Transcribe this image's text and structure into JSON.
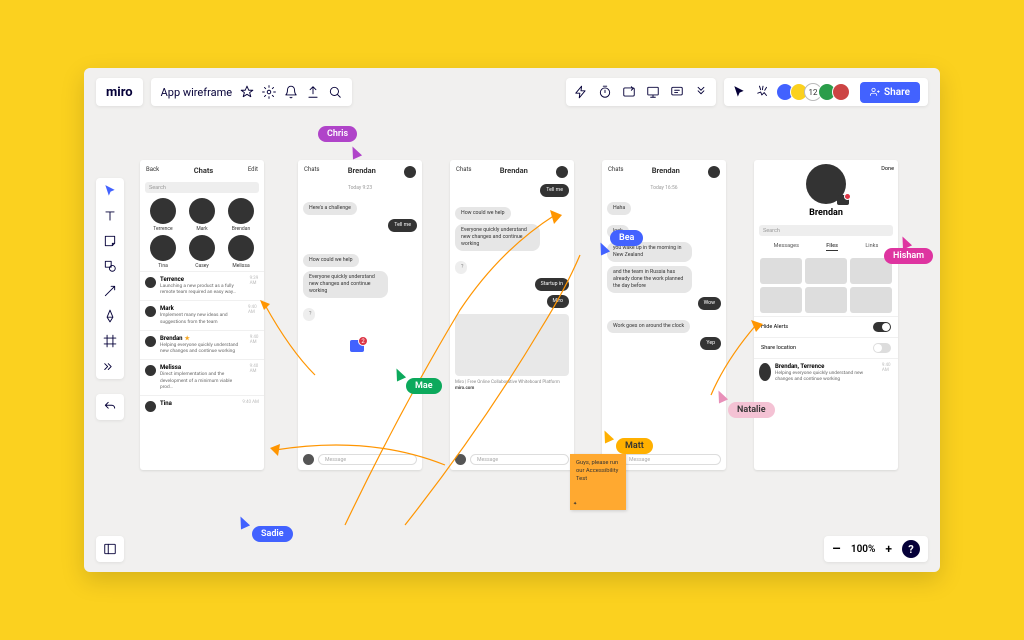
{
  "header": {
    "logo": "miro",
    "board_title": "App wireframe",
    "share": "Share",
    "avatar_count": "12"
  },
  "zoom": {
    "level": "100%",
    "minus": "–",
    "plus": "+",
    "help": "?"
  },
  "mocks": {
    "m1": {
      "back": "Back",
      "title": "Chats",
      "edit": "Edit",
      "search": "Search",
      "avatars": [
        "Terrence",
        "Mark",
        "Brendan",
        "Tina",
        "Casey",
        "Melissa"
      ],
      "rows": [
        {
          "name": "Terrence",
          "time": "9:39 AM",
          "msg": "Launching a new product as a fully remote team required an easy way…"
        },
        {
          "name": "Mark",
          "time": "9:40 AM",
          "msg": "Implement many new ideas and suggestions from the team"
        },
        {
          "name": "Brendan",
          "time": "9:40 AM",
          "msg": "Helping everyone quickly understand new changes and continue working",
          "star": true
        },
        {
          "name": "Melissa",
          "time": "9:40 AM",
          "msg": "Direct implementation and the development of a minimum viable prod…"
        },
        {
          "name": "Tina",
          "time": "9:40 AM",
          "msg": ""
        }
      ]
    },
    "m2": {
      "left": "Chats",
      "title": "Brendan",
      "time": "Today 9:23",
      "b1": "Here's a challenge",
      "b2": "Tell me",
      "b3": "How could we help",
      "b4": "Everyone quickly understand new changes and continue working",
      "q": "?",
      "input": "Message"
    },
    "m3": {
      "left": "Chats",
      "title": "Brendan",
      "b1": "Tell me",
      "b2": "How could we help",
      "b3": "Everyone quickly understand new changes and continue working",
      "q": "?",
      "b4": "Startup in",
      "b5": "Miro",
      "meta1": "Miro | Free Online Collaborative Whiteboard Platform",
      "meta2": "miro.com",
      "input": "Message"
    },
    "m4": {
      "left": "Chats",
      "title": "Brendan",
      "time": "Today 16:56",
      "b1": "Haha",
      "b2": "look",
      "b3": "you wake up in the morning in New Zealand",
      "b4": "and the team in Russia has already done the work planned the day before",
      "b5": "Wow",
      "b6": "Work goes on around the clock",
      "b7": "Yep",
      "input": "Message"
    },
    "m5": {
      "done": "Done",
      "name": "Brendan",
      "search": "Search",
      "tabs": [
        "Messages",
        "Files",
        "Links"
      ],
      "s1": "Hide Alerts",
      "s2": "Share location",
      "row_names": "Brendan, Terrence",
      "row_time": "9:40 AM",
      "row_msg": "Helping everyone quickly understand new changes and continue working"
    }
  },
  "cursors": {
    "chris": "Chris",
    "bea": "Bea",
    "mae": "Mae",
    "matt": "Matt",
    "sadie": "Sadie",
    "natalie": "Natalie",
    "hisham": "Hisham"
  },
  "sticky": "Guys, please run our Accessibility Test"
}
